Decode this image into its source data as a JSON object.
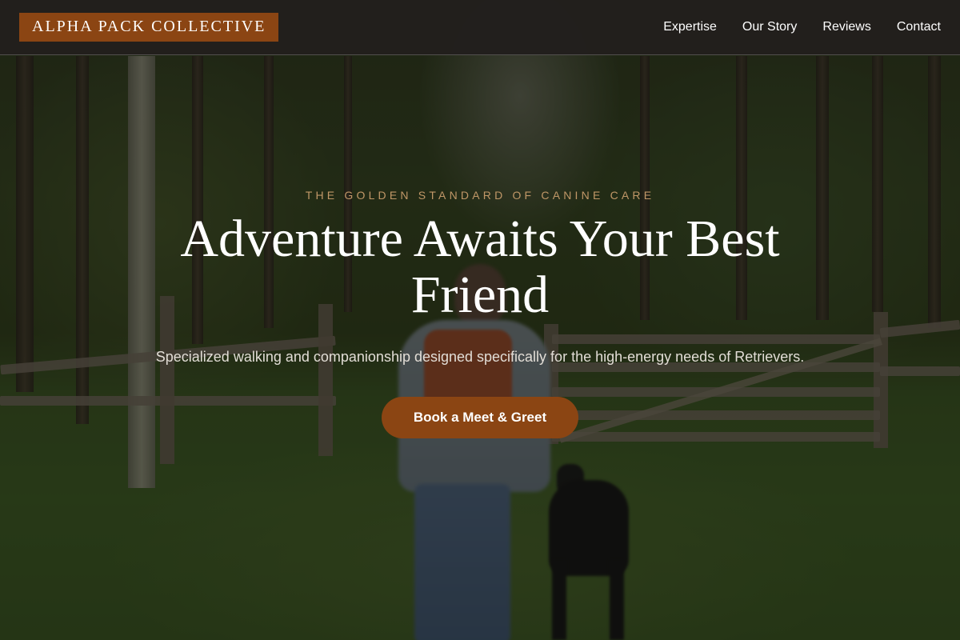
{
  "brand": {
    "logo_text": "ALPHA PACK COLLECTIVE",
    "accent_color": "#8B4513"
  },
  "nav": {
    "items": [
      {
        "label": "Expertise"
      },
      {
        "label": "Our Story"
      },
      {
        "label": "Reviews"
      },
      {
        "label": "Contact"
      }
    ]
  },
  "hero": {
    "eyebrow": "THE GOLDEN STANDARD OF CANINE CARE",
    "headline": "Adventure Awaits Your Best Friend",
    "subtext": "Specialized walking and companionship designed specifically for the high-energy needs of Retrievers.",
    "cta_label": "Book a Meet & Greet",
    "background_image": "forest-path-walker-with-dog"
  }
}
